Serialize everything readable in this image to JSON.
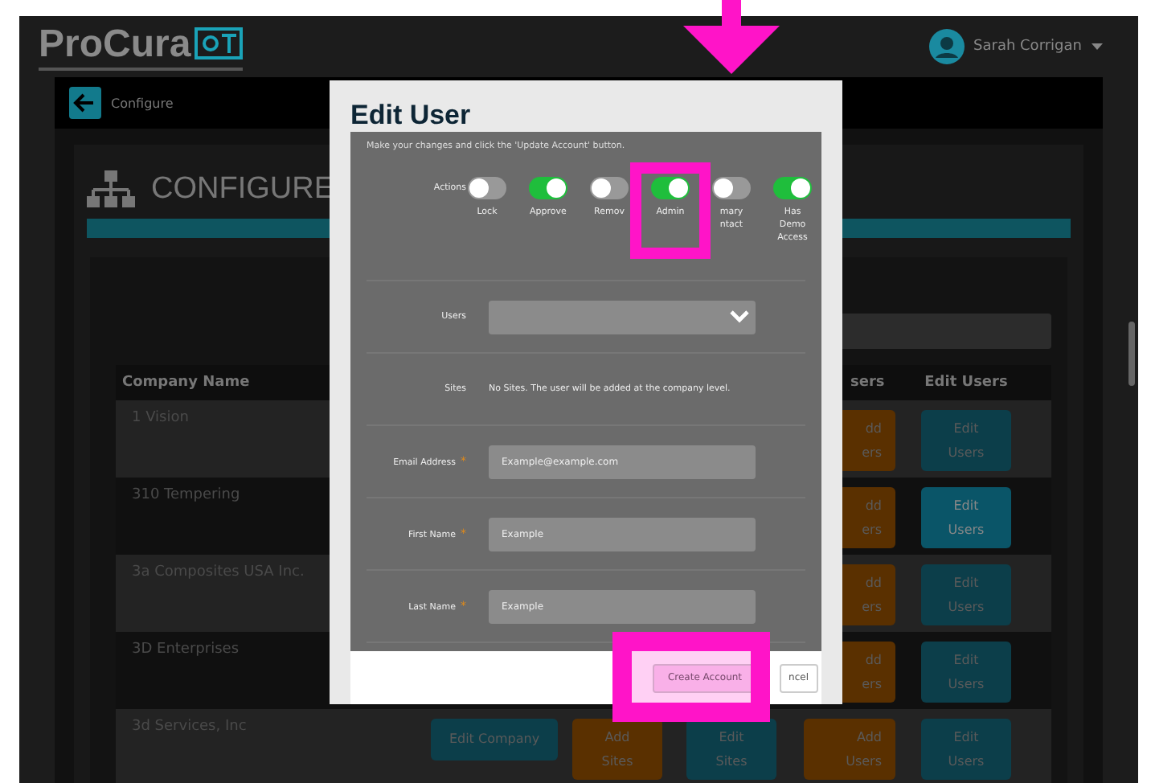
{
  "header": {
    "logo_text": "ProCura",
    "user_name": "Sarah Corrigan"
  },
  "breadcrumb": {
    "label": "Configure"
  },
  "page_heading": "CONFIGURE",
  "table": {
    "columns": [
      "Company Name",
      "sers",
      "Edit Users"
    ],
    "rows": [
      {
        "company": "1 Vision",
        "add_users": "dd\ners",
        "edit_users": "Edit\nUsers",
        "selected": false
      },
      {
        "company": "310 Tempering",
        "add_users": "dd\ners",
        "edit_users": "Edit\nUsers",
        "selected": true
      },
      {
        "company": "3a Composites USA Inc.",
        "add_users": "dd\ners",
        "edit_users": "Edit\nUsers",
        "selected": false
      },
      {
        "company": "3D Enterprises",
        "add_users": "dd\ners",
        "edit_users": "Edit\nUsers",
        "selected": false
      },
      {
        "company": "3d Services, Inc",
        "edit_company": "Edit Company",
        "add_sites": "Add\nSites",
        "edit_sites": "Edit\nSites",
        "add_users": "Add\nUsers",
        "edit_users": "Edit\nUsers",
        "selected": false
      }
    ]
  },
  "modal": {
    "title": "Edit User",
    "instruction": "Make your changes and click the 'Update Account' button.",
    "actions_label": "Actions",
    "toggles": [
      {
        "label": "Lock",
        "on": false
      },
      {
        "label": "Approve",
        "on": true
      },
      {
        "label": "Remov",
        "on": false
      },
      {
        "label": "Admin",
        "on": true
      },
      {
        "label": "mary\nntact",
        "on": false
      },
      {
        "label": "Has Demo Access",
        "on": true
      }
    ],
    "users": {
      "label": "Users"
    },
    "sites": {
      "label": "Sites",
      "text": "No Sites. The user will be added at the company level."
    },
    "fields": [
      {
        "label": "Email Address",
        "required_mark": "*",
        "value": "Example@example.com"
      },
      {
        "label": "First Name",
        "required_mark": "*",
        "value": "Example"
      },
      {
        "label": "Last Name",
        "required_mark": "*",
        "value": "Example"
      }
    ],
    "buttons": [
      "Create Account",
      "ncel"
    ]
  }
}
